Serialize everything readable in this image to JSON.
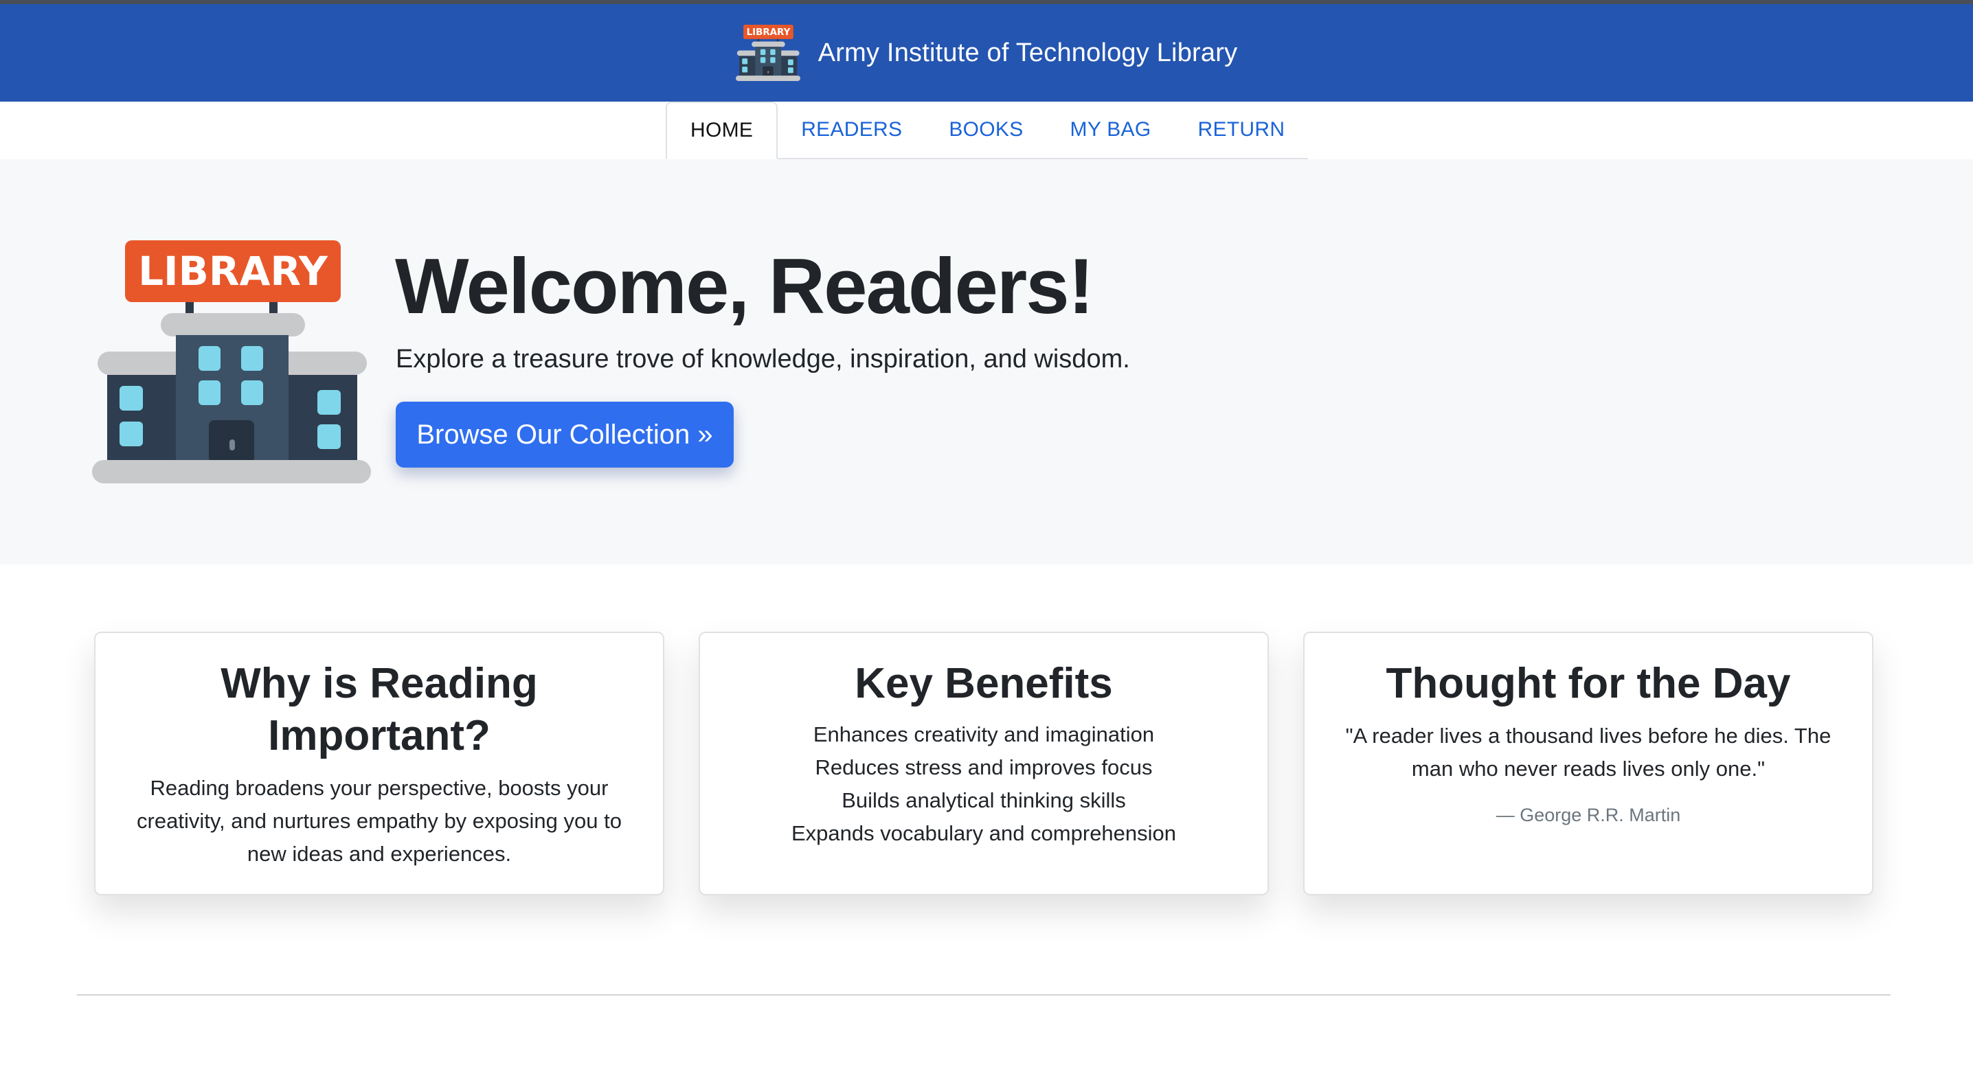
{
  "header": {
    "title": "Army Institute of Technology Library",
    "logo_icon": "library-building-icon",
    "logo_sign_text": "LIBRARY",
    "background": "#2455b0"
  },
  "nav": {
    "items": [
      {
        "label": "HOME",
        "active": true
      },
      {
        "label": "READERS",
        "active": false
      },
      {
        "label": "BOOKS",
        "active": false
      },
      {
        "label": "MY BAG",
        "active": false
      },
      {
        "label": "RETURN",
        "active": false
      }
    ],
    "link_color": "#1a63d8"
  },
  "hero": {
    "logo_icon": "library-building-icon",
    "logo_sign_text": "LIBRARY",
    "title": "Welcome, Readers!",
    "subtitle": "Explore a treasure trove of knowledge, inspiration, and wisdom.",
    "button_label": "Browse Our Collection »",
    "button_color": "#2f6eef"
  },
  "cards": {
    "why": {
      "title": "Why is Reading Important?",
      "body": "Reading broadens your perspective, boosts your creativity, and nurtures empathy by exposing you to new ideas and experiences."
    },
    "benefits": {
      "title": "Key Benefits",
      "items": [
        "Enhances creativity and imagination",
        "Reduces stress and improves focus",
        "Builds analytical thinking skills",
        "Expands vocabulary and comprehension"
      ]
    },
    "thought": {
      "title": "Thought for the Day",
      "quote": "\"A reader lives a thousand lives before he dies. The man who never reads lives only one.\"",
      "author": "— George R.R. Martin"
    }
  }
}
